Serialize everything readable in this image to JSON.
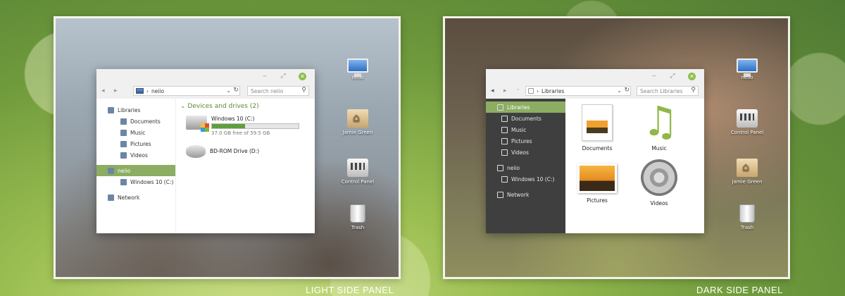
{
  "captions": {
    "light": "LIGHT SIDE PANEL",
    "dark": "DARK SIDE PANEL"
  },
  "light": {
    "address": "neiio",
    "search_placeholder": "Search neiio",
    "sidebar": [
      {
        "label": "Libraries",
        "icon": "libraries-icon"
      },
      {
        "label": "Documents",
        "icon": "documents-icon"
      },
      {
        "label": "Music",
        "icon": "music-icon"
      },
      {
        "label": "Pictures",
        "icon": "pictures-icon"
      },
      {
        "label": "Videos",
        "icon": "videos-icon"
      },
      {
        "label": "neiio",
        "icon": "computer-icon"
      },
      {
        "label": "Windows 10 (C:)",
        "icon": "drive-icon"
      },
      {
        "label": "Network",
        "icon": "network-icon"
      }
    ],
    "group_heading": "Devices and drives (2)",
    "drives": [
      {
        "name": "Windows 10 (C:)",
        "free_text": "37.0 GB free of 59.5 GB",
        "used_fraction": 0.38
      },
      {
        "name": "BD-ROM Drive (D:)"
      }
    ],
    "desktop": [
      {
        "label": "neiio",
        "icon": "computer-icon"
      },
      {
        "label": "Jamie Green",
        "icon": "home-folder-icon"
      },
      {
        "label": "Control Panel",
        "icon": "control-panel-icon"
      },
      {
        "label": "Trash",
        "icon": "trash-icon"
      }
    ]
  },
  "dark": {
    "address": "Libraries",
    "search_placeholder": "Search Libraries",
    "sidebar": [
      {
        "label": "Libraries",
        "icon": "libraries-icon"
      },
      {
        "label": "Documents",
        "icon": "documents-icon"
      },
      {
        "label": "Music",
        "icon": "music-icon"
      },
      {
        "label": "Pictures",
        "icon": "pictures-icon"
      },
      {
        "label": "Videos",
        "icon": "videos-icon"
      },
      {
        "label": "neiio",
        "icon": "computer-icon"
      },
      {
        "label": "Windows 10 (C:)",
        "icon": "drive-icon"
      },
      {
        "label": "Network",
        "icon": "network-icon"
      }
    ],
    "libraries": [
      {
        "label": "Documents",
        "icon": "documents-library-icon"
      },
      {
        "label": "Music",
        "icon": "music-library-icon"
      },
      {
        "label": "Pictures",
        "icon": "pictures-library-icon"
      },
      {
        "label": "Videos",
        "icon": "videos-library-icon"
      }
    ],
    "desktop": [
      {
        "label": "neiio",
        "icon": "computer-icon"
      },
      {
        "label": "Control Panel",
        "icon": "control-panel-icon"
      },
      {
        "label": "Jamie Green",
        "icon": "home-folder-icon"
      },
      {
        "label": "Trash",
        "icon": "trash-icon"
      }
    ]
  },
  "window_controls": {
    "minimize": "‒",
    "maximize": "⤢",
    "close": "✕"
  },
  "nav_glyphs": {
    "back": "◂",
    "forward": "▸",
    "up": "⌃",
    "dropdown": "⌄",
    "refresh": "↻",
    "search": "⚲"
  },
  "accent_color": "#8cad62"
}
